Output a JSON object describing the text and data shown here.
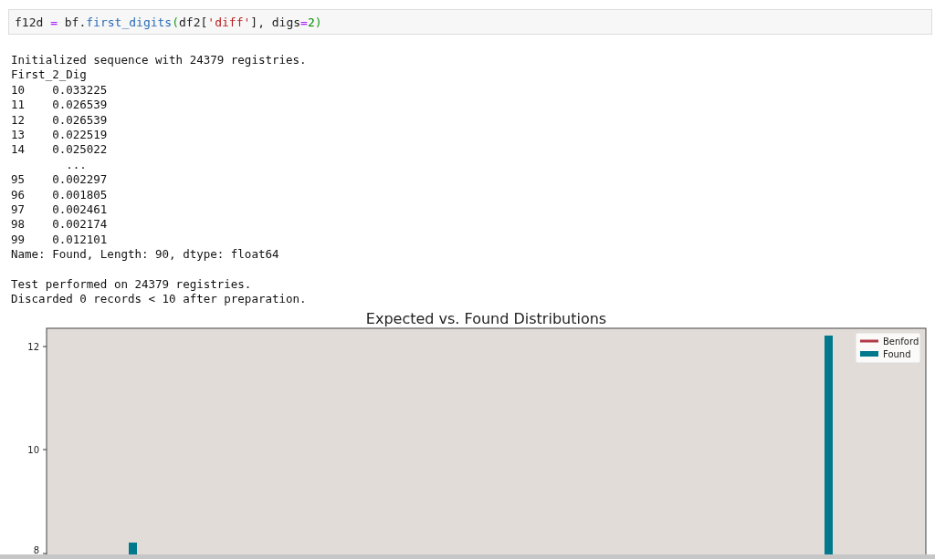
{
  "code_cell": {
    "tokens": [
      {
        "text": "f12d ",
        "kind": "plain"
      },
      {
        "text": "=",
        "kind": "operator"
      },
      {
        "text": " bf.",
        "kind": "plain"
      },
      {
        "text": "first_digits",
        "kind": "function"
      },
      {
        "text": "(",
        "kind": "paren"
      },
      {
        "text": "df2[",
        "kind": "plain"
      },
      {
        "text": "'diff'",
        "kind": "string"
      },
      {
        "text": "], digs",
        "kind": "plain"
      },
      {
        "text": "=",
        "kind": "operator"
      },
      {
        "text": "2",
        "kind": "number"
      },
      {
        "text": ")",
        "kind": "paren"
      }
    ]
  },
  "output_blocks": [
    [
      "Initialized sequence with 24379 registries.",
      "First_2_Dig",
      "10    0.033225",
      "11    0.026539",
      "12    0.026539",
      "13    0.022519",
      "14    0.025022",
      "        ...",
      "95    0.002297",
      "96    0.001805",
      "97    0.002461",
      "98    0.002174",
      "99    0.012101",
      "Name: Found, Length: 90, dtype: float64"
    ],
    [
      "Test performed on 24379 registries.",
      "Discarded 0 records < 10 after preparation."
    ]
  ],
  "chart": {
    "title": "Expected vs. Found Distributions",
    "y_tick_labels": [
      "12",
      "10",
      "8"
    ],
    "legend": [
      {
        "label": "Benford",
        "kind": "line",
        "color": "#b23a48"
      },
      {
        "label": "Found",
        "kind": "bar",
        "color": "#00798c"
      }
    ]
  }
}
